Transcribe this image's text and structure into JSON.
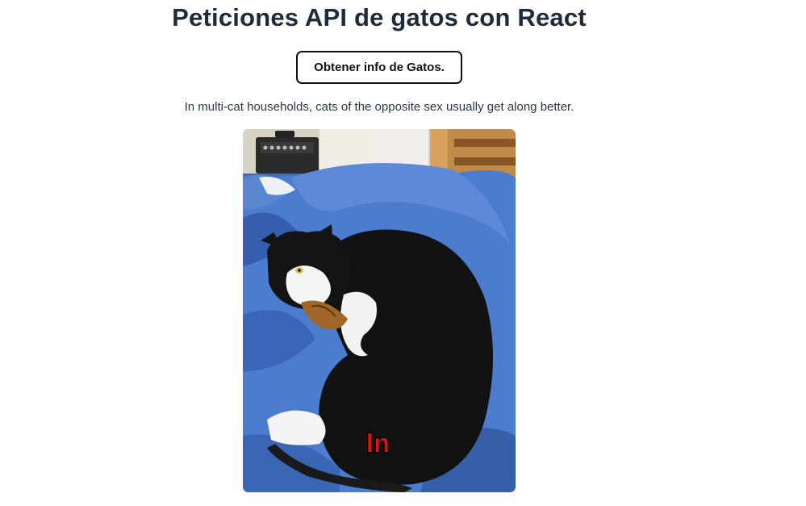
{
  "header": {
    "title": "Peticiones API de gatos con React"
  },
  "actions": {
    "fetch_label": "Obtener info de Gatos."
  },
  "fact": {
    "text": "In multi-cat households, cats of the opposite sex usually get along better."
  },
  "image": {
    "overlay_word": "In"
  },
  "colors": {
    "title": "#1e2b3a",
    "overlay_text": "#e01010",
    "blanket": "#4a78c8"
  }
}
